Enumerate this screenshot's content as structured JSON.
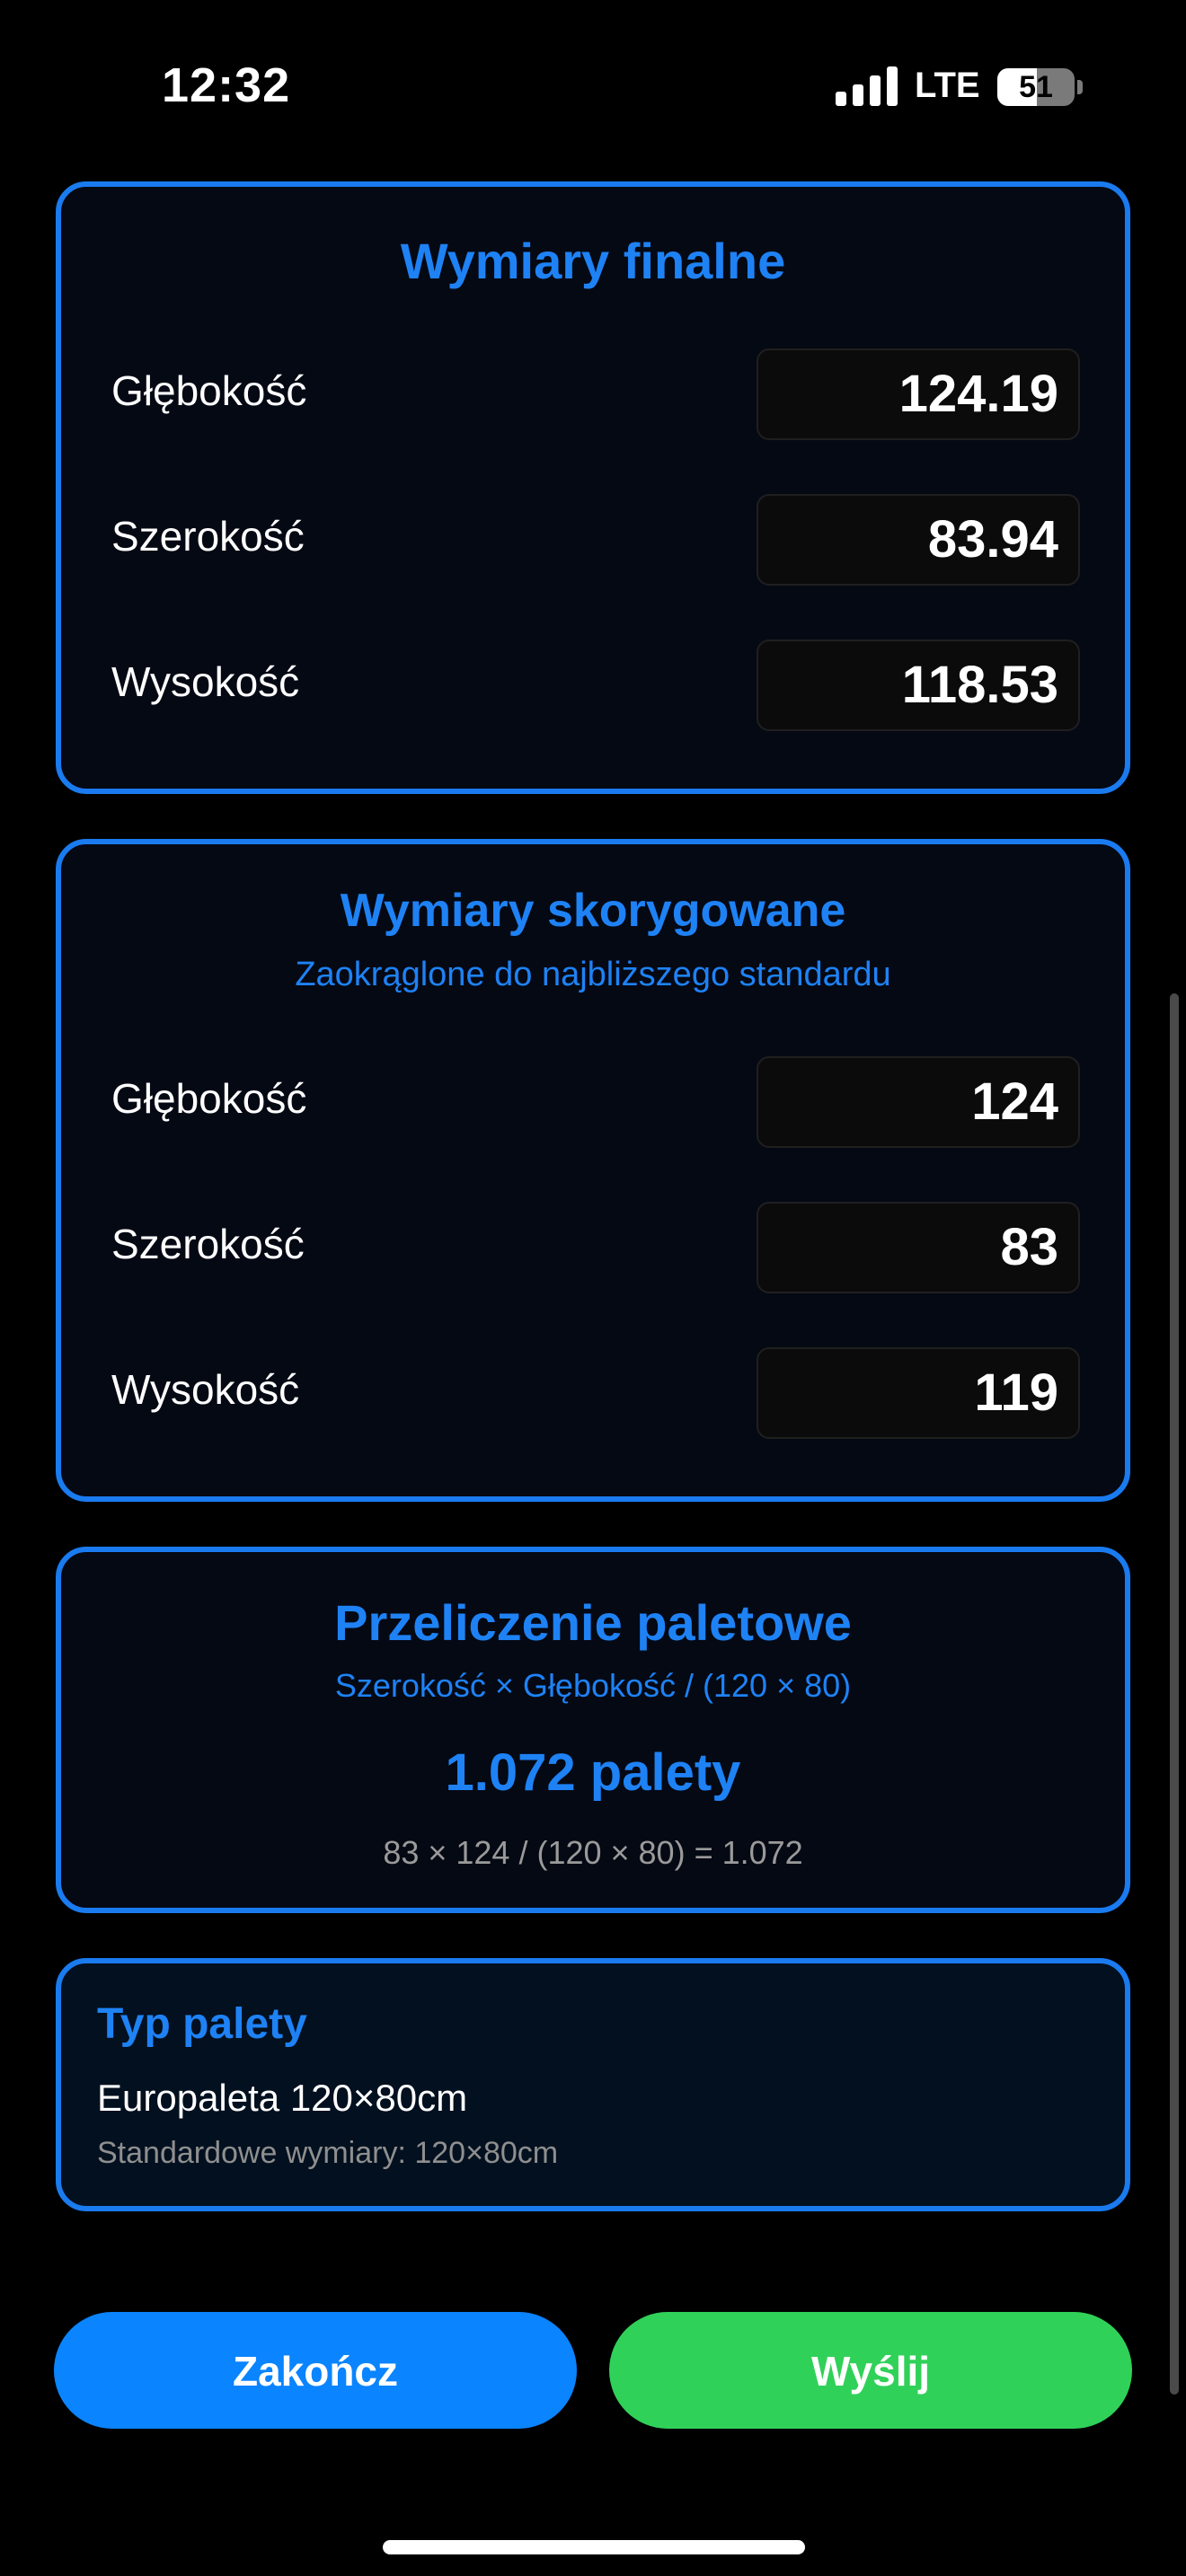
{
  "status_bar": {
    "time": "12:32",
    "network": "LTE",
    "battery": "51",
    "battery_level": 0.51
  },
  "final_dimensions": {
    "title": "Wymiary finalne",
    "rows": [
      {
        "label": "Głębokość",
        "value": "124.19"
      },
      {
        "label": "Szerokość",
        "value": "83.94"
      },
      {
        "label": "Wysokość",
        "value": "118.53"
      }
    ]
  },
  "corrected_dimensions": {
    "title": "Wymiary skorygowane",
    "subtitle": "Zaokrąglone do najbliższego standardu",
    "rows": [
      {
        "label": "Głębokość",
        "value": "124"
      },
      {
        "label": "Szerokość",
        "value": "83"
      },
      {
        "label": "Wysokość",
        "value": "119"
      }
    ]
  },
  "pallet_calc": {
    "title": "Przeliczenie paletowe",
    "formula_desc": "Szerokość × Głębokość / (120 × 80)",
    "result": "1.072 palety",
    "formula": "83 × 124 / (120 × 80) = 1.072"
  },
  "pallet_type": {
    "title": "Typ palety",
    "name": "Europaleta 120×80cm",
    "description": "Standardowe wymiary: 120×80cm"
  },
  "buttons": {
    "finish": "Zakończ",
    "send": "Wyślij"
  },
  "colors": {
    "accent": "#1a7bf0",
    "primary_button": "#0a84ff",
    "send_button": "#30d158",
    "background": "#000000"
  }
}
